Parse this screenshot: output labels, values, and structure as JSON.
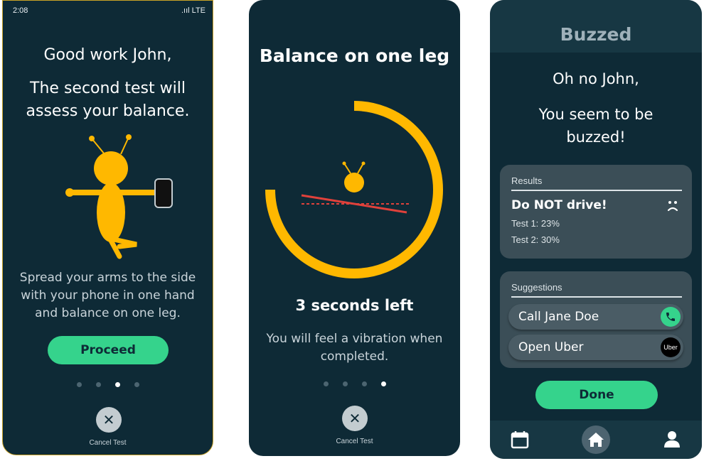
{
  "screen1": {
    "status_time": "2:08",
    "status_signal": ".ııl LTE",
    "greeting": "Good work John,",
    "message_line1": "The second test will",
    "message_line2": "assess your balance.",
    "instruction_line1": "Spread your arms to the side",
    "instruction_line2": "with your phone in one hand",
    "instruction_line3": "and balance on one leg.",
    "proceed_label": "Proceed",
    "cancel_symbol": "✕",
    "cancel_label": "Cancel Test",
    "active_dot": 3
  },
  "screen2": {
    "title": "Balance on one leg",
    "countdown": "3 seconds left",
    "note_line1": "You will feel a vibration when",
    "note_line2": "completed.",
    "cancel_symbol": "✕",
    "cancel_label": "Cancel Test",
    "active_dot": 4,
    "timer_progress": 0.75
  },
  "screen3": {
    "brand": "Buzzed",
    "greeting": "Oh no John,",
    "message_line1": "You seem to be",
    "message_line2": "buzzed!",
    "results": {
      "title": "Results",
      "verdict": "Do NOT drive!",
      "verdict_icon": "sad-face-icon",
      "test1": "Test 1:   23%",
      "test2": "Test 2:   30%"
    },
    "suggestions": {
      "title": "Suggestions",
      "call_label": "Call Jane Doe",
      "call_icon": "phone-icon",
      "uber_label": "Open Uber",
      "uber_icon_text": "Uber"
    },
    "done_label": "Done",
    "nav": [
      "calendar-icon",
      "home-icon",
      "profile-icon"
    ]
  },
  "colors": {
    "background": "#0e2a36",
    "accent_yellow": "#ffb800",
    "accent_green": "#35d38c",
    "warning_red": "#e0413b"
  }
}
